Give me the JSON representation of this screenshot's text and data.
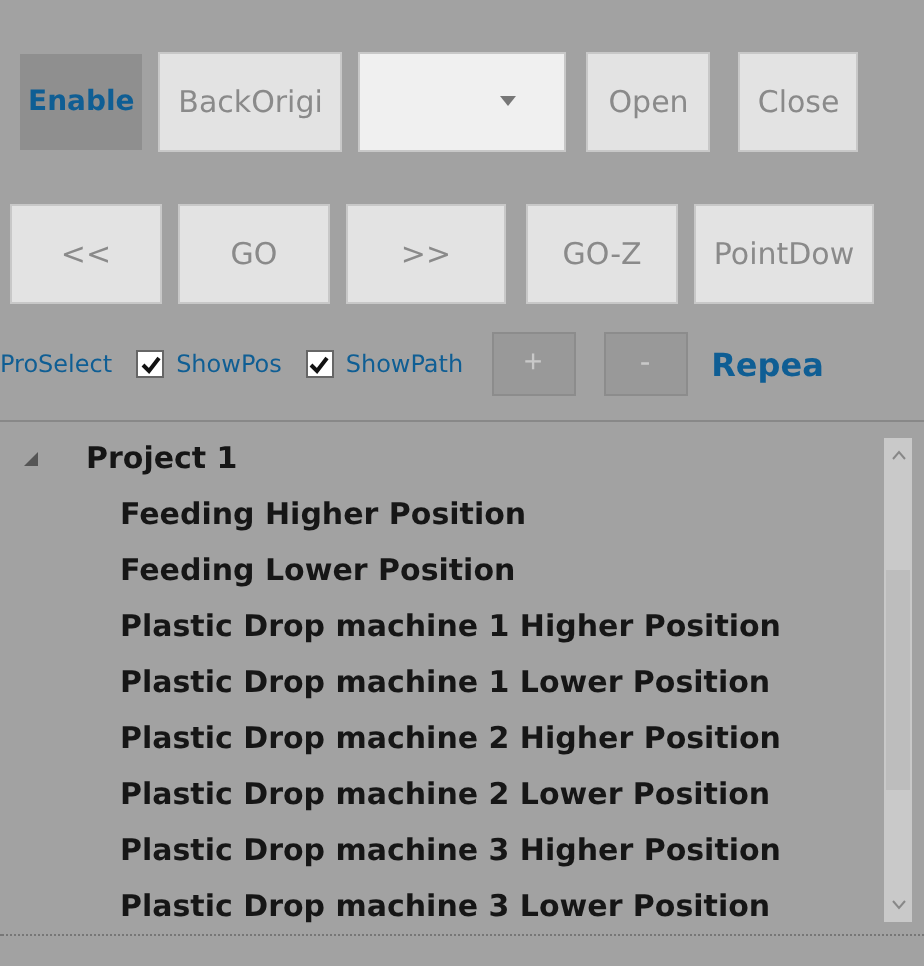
{
  "toolbar_row_1": [
    {
      "kind": "label",
      "text": "Enable"
    },
    {
      "kind": "button",
      "text": "BackOrigi"
    },
    {
      "kind": "dropdown"
    },
    {
      "kind": "button",
      "text": "Open"
    },
    {
      "kind": "button",
      "text": "Close"
    }
  ],
  "toolbar_row_2": [
    {
      "kind": "button",
      "text": "<<"
    },
    {
      "kind": "button",
      "text": "GO"
    },
    {
      "kind": "button",
      "text": ">>"
    },
    {
      "kind": "button",
      "text": "GO-Z"
    },
    {
      "kind": "button",
      "text": "PointDow"
    }
  ],
  "toolbar_row_3": [
    {
      "kind": "label",
      "text": "ProSelect"
    },
    {
      "kind": "checkbox",
      "text": "ShowPos",
      "checked": true
    },
    {
      "kind": "checkbox",
      "text": "ShowPath",
      "checked": true
    },
    {
      "kind": "button",
      "text": "+"
    },
    {
      "kind": "button",
      "text": "-"
    },
    {
      "kind": "label",
      "text": "Repea"
    }
  ],
  "tree": [
    {
      "label": "Project 1",
      "expanded": true,
      "children": [
        {
          "label": "Feeding Higher Position"
        },
        {
          "label": "Feeding Lower Position"
        },
        {
          "label": "Plastic Drop machine 1 Higher Position"
        },
        {
          "label": "Plastic Drop machine 1 Lower Position"
        },
        {
          "label": "Plastic Drop machine 2 Higher Position"
        },
        {
          "label": "Plastic Drop machine 2 Lower Position"
        },
        {
          "label": "Plastic Drop machine 3 Higher Position"
        },
        {
          "label": "Plastic Drop machine 3 Lower Position"
        }
      ]
    }
  ]
}
